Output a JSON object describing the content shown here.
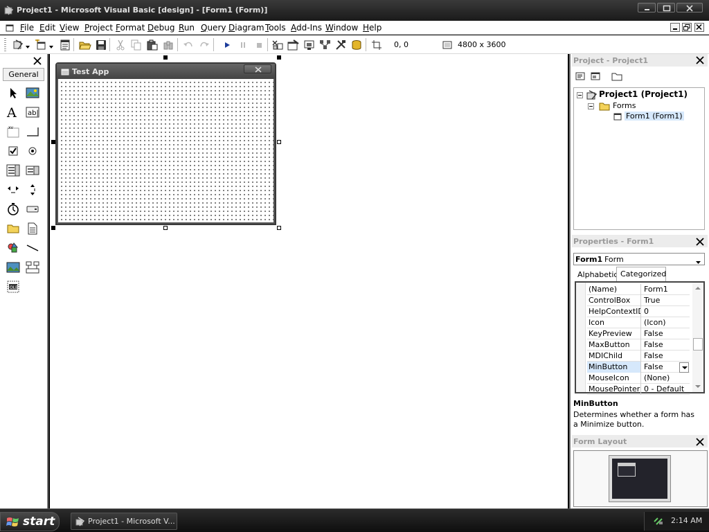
{
  "window": {
    "title": "Project1 - Microsoft Visual Basic [design] - [Form1 (Form)]"
  },
  "menubar": {
    "items": [
      "File",
      "Edit",
      "View",
      "Project",
      "Format",
      "Debug",
      "Run",
      "Query",
      "Diagram",
      "Tools",
      "Add-Ins",
      "Window",
      "Help"
    ]
  },
  "toolbar": {
    "position_readout": "0, 0",
    "size_readout": "4800 x 3600"
  },
  "toolbox": {
    "tab_label": "General",
    "tools": [
      "pointer",
      "picturebox",
      "label",
      "textbox",
      "frame",
      "commandbutton",
      "checkbox",
      "optionbutton",
      "combobox",
      "listbox",
      "hscrollbar",
      "vscrollbar",
      "timer",
      "drivelistbox",
      "dirlistbox",
      "filelistbox",
      "shape",
      "line",
      "image",
      "data",
      "ole"
    ]
  },
  "form": {
    "caption": "Test App"
  },
  "project_panel": {
    "title": "Project - Project1",
    "tree": {
      "root": "Project1 (Project1)",
      "folder": "Forms",
      "item": "Form1 (Form1)"
    }
  },
  "properties_panel": {
    "title": "Properties - Form1",
    "object_name": "Form1",
    "object_type": "Form",
    "tabs": [
      "Alphabetic",
      "Categorized"
    ],
    "active_tab": "Categorized",
    "rows": [
      {
        "name": "(Name)",
        "value": "Form1"
      },
      {
        "name": "ControlBox",
        "value": "True"
      },
      {
        "name": "HelpContextID",
        "value": "0"
      },
      {
        "name": "Icon",
        "value": "(Icon)"
      },
      {
        "name": "KeyPreview",
        "value": "False"
      },
      {
        "name": "MaxButton",
        "value": "False"
      },
      {
        "name": "MDIChild",
        "value": "False"
      },
      {
        "name": "MinButton",
        "value": "False"
      },
      {
        "name": "MouseIcon",
        "value": "(None)"
      },
      {
        "name": "MousePointer",
        "value": "0 - Default"
      }
    ],
    "selected_row": "MinButton",
    "description_title": "MinButton",
    "description_text": "Determines whether a form has a Minimize button."
  },
  "form_layout_panel": {
    "title": "Form Layout"
  },
  "taskbar": {
    "start_label": "start",
    "task_label": "Project1 - Microsoft V...",
    "clock": "2:14 AM"
  },
  "colors": {
    "selected_highlight": "#d6e8fb",
    "titlebar": "#2a2a2a"
  }
}
